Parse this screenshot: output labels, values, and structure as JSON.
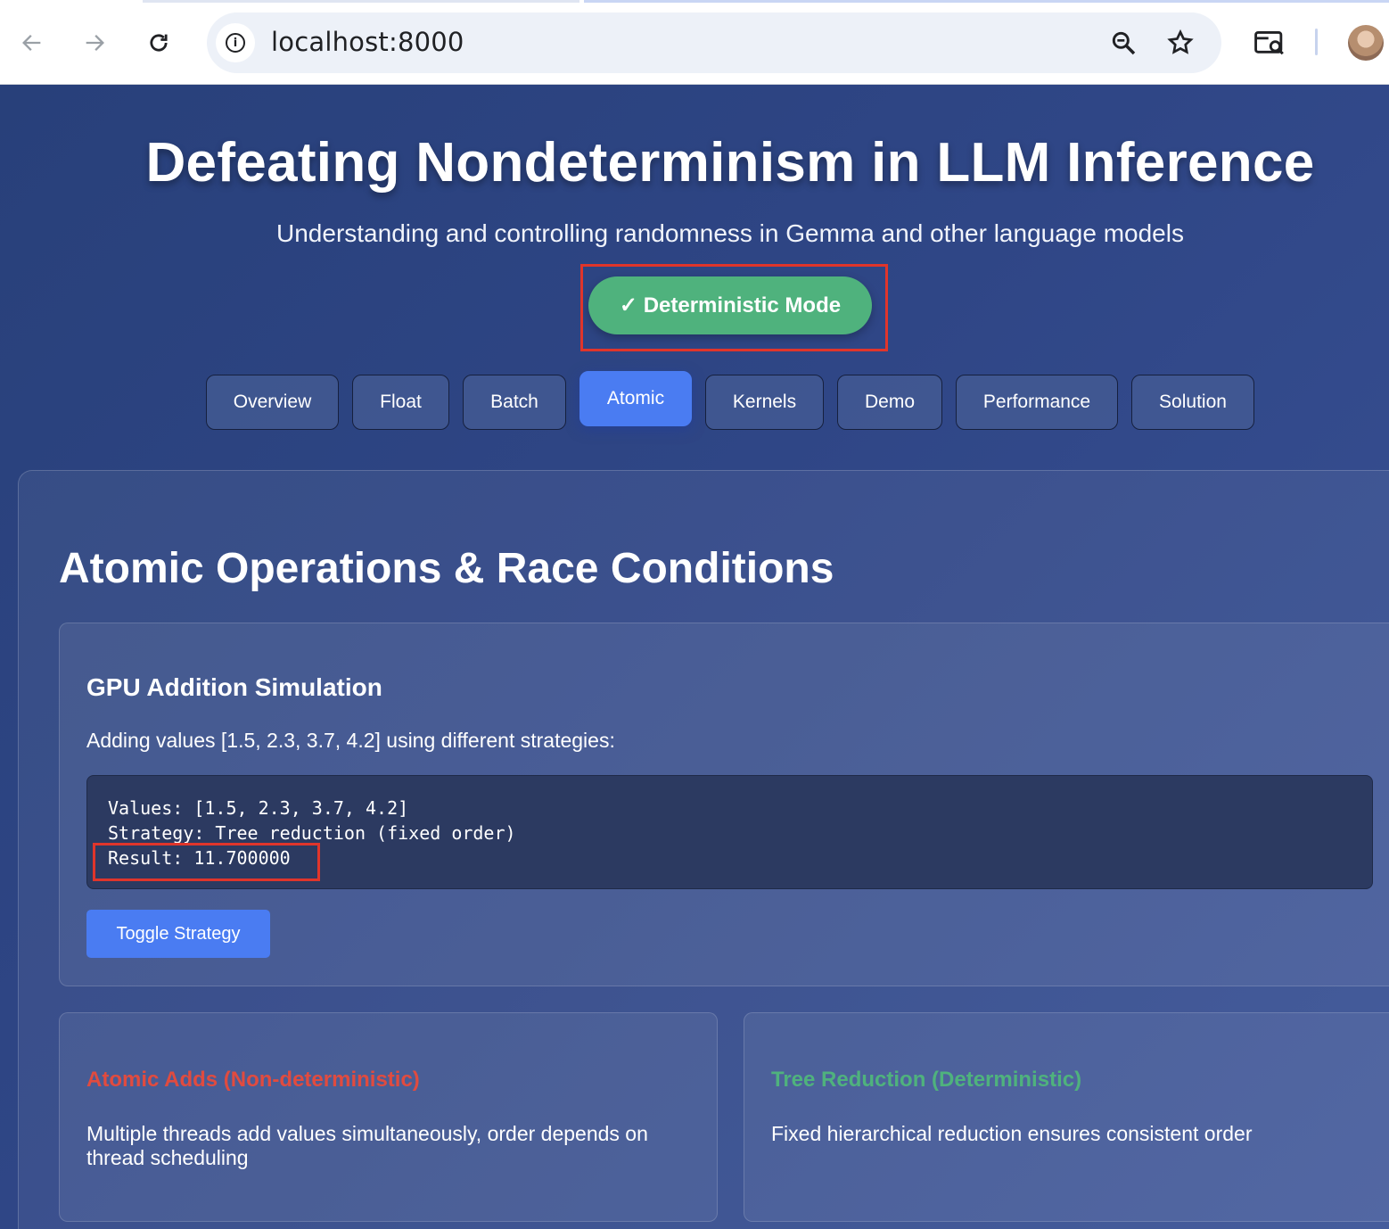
{
  "browser": {
    "url": "localhost:8000",
    "back_icon": "arrow-left-icon",
    "forward_icon": "arrow-right-icon",
    "reload_icon": "reload-icon",
    "info_glyph": "i"
  },
  "header": {
    "title": "Defeating Nondeterminism in LLM Inference",
    "subtitle": "Understanding and controlling randomness in Gemma and other language models",
    "mode_badge": "✓ Deterministic Mode"
  },
  "tabs": [
    {
      "label": "Overview",
      "active": false
    },
    {
      "label": "Float",
      "active": false
    },
    {
      "label": "Batch",
      "active": false
    },
    {
      "label": "Atomic",
      "active": true
    },
    {
      "label": "Kernels",
      "active": false
    },
    {
      "label": "Demo",
      "active": false
    },
    {
      "label": "Performance",
      "active": false
    },
    {
      "label": "Solution",
      "active": false
    }
  ],
  "section": {
    "title": "Atomic Operations & Race Conditions",
    "simulation": {
      "title": "GPU Addition Simulation",
      "description": "Adding values [1.5, 2.3, 3.7, 4.2] using different strategies:",
      "code_lines": [
        "Values: [1.5, 2.3, 3.7, 4.2]",
        "Strategy: Tree reduction (fixed order)",
        "Result: 11.700000"
      ],
      "toggle_label": "Toggle Strategy"
    },
    "cards": [
      {
        "title": "Atomic Adds (Non-deterministic)",
        "line1": "Multiple threads add values simultaneously, order depends on",
        "line2": "thread scheduling",
        "color": "#e14b3f"
      },
      {
        "title": "Tree Reduction (Deterministic)",
        "line1": "Fixed hierarchical reduction ensures consistent order",
        "line2": "",
        "color": "#4fb27d"
      }
    ]
  },
  "colors": {
    "accent": "#4a7cf2",
    "success": "#4fb27d",
    "error": "#e14b3f",
    "annotation": "#e0352b"
  }
}
